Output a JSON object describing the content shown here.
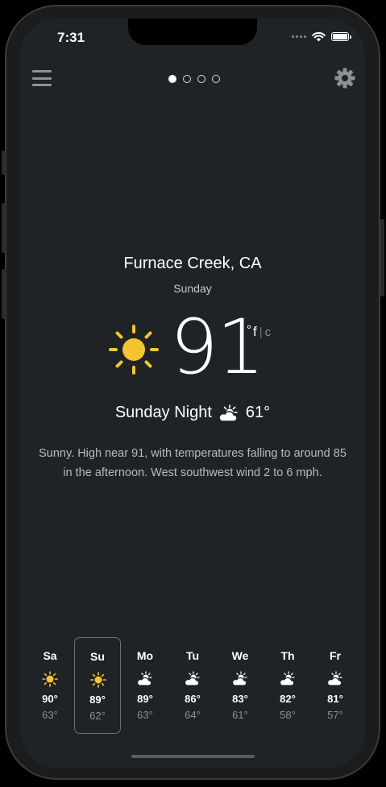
{
  "status_bar": {
    "time": "7:31",
    "icons": [
      "cellular-dots-icon",
      "wifi-icon",
      "battery-icon"
    ]
  },
  "top_bar": {
    "menu_icon": "hamburger-menu-icon",
    "settings_icon": "gear-icon",
    "page_count": 4,
    "active_page": 1
  },
  "location": "Furnace Creek, CA",
  "day": "Sunday",
  "current": {
    "temperature": "91",
    "icon": "sun-icon",
    "unit_degree": "°",
    "unit_f": "f",
    "unit_separator": "|",
    "unit_c": "c"
  },
  "night": {
    "label": "Sunday Night",
    "icon": "partly-cloudy-night-icon",
    "temperature": "61°"
  },
  "description": "Sunny. High near 91, with temperatures falling to around 85 in the afternoon. West southwest wind 2 to 6 mph.",
  "forecast": [
    {
      "day": "Sa",
      "icon": "sun-icon",
      "high": "90°",
      "low": "63°",
      "selected": false
    },
    {
      "day": "Su",
      "icon": "sun-icon",
      "high": "89°",
      "low": "62°",
      "selected": true
    },
    {
      "day": "Mo",
      "icon": "partly-cloudy-icon",
      "high": "89°",
      "low": "63°",
      "selected": false
    },
    {
      "day": "Tu",
      "icon": "partly-cloudy-icon",
      "high": "86°",
      "low": "64°",
      "selected": false
    },
    {
      "day": "We",
      "icon": "partly-cloudy-icon",
      "high": "83°",
      "low": "61°",
      "selected": false
    },
    {
      "day": "Th",
      "icon": "partly-cloudy-icon",
      "high": "82°",
      "low": "58°",
      "selected": false
    },
    {
      "day": "Fr",
      "icon": "partly-cloudy-icon",
      "high": "81°",
      "low": "57°",
      "selected": false
    }
  ],
  "colors": {
    "background": "#202326",
    "sun": "#f5c530",
    "text_primary": "#ffffff",
    "text_secondary": "#8d9094"
  }
}
